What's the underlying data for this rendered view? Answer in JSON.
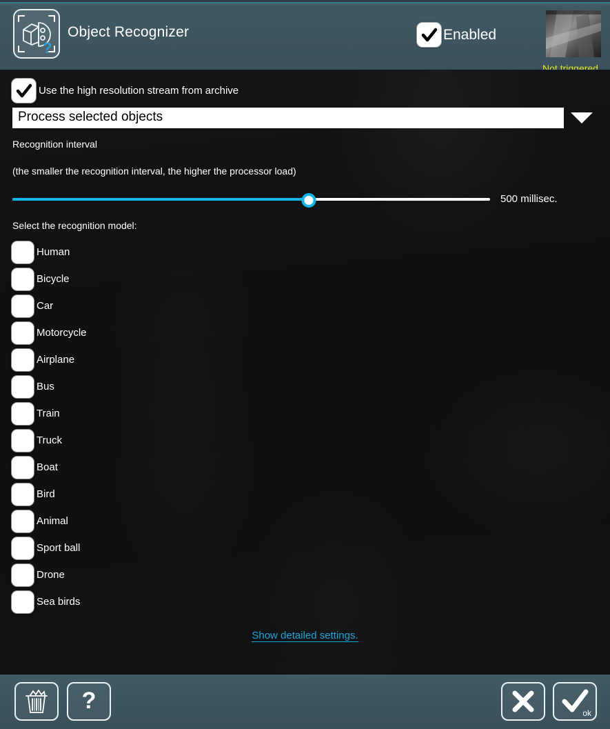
{
  "header": {
    "app_icon": "object-recognizer-icon",
    "title": "Object Recognizer",
    "enabled_label": "Enabled",
    "enabled_checked": true,
    "thumbnail_status": "Not triggered",
    "status_color": "#e8e81f",
    "background_color": "#3d555f"
  },
  "main": {
    "high_res": {
      "label": "Use the high resolution stream from archive",
      "checked": true
    },
    "mode_select": {
      "value": "Process selected objects",
      "arrow_icon": "chevron-down-icon"
    },
    "interval": {
      "label": "Recognition interval",
      "hint": "(the smaller the recognition interval, the higher the processor load)",
      "value_text": "500 millisec.",
      "percent": 62,
      "fill_color": "#13b5ea",
      "track_color": "#ffffff"
    },
    "models": {
      "label": "Select the recognition model:",
      "items": [
        {
          "label": "Human",
          "checked": false
        },
        {
          "label": "Bicycle",
          "checked": false
        },
        {
          "label": "Car",
          "checked": false
        },
        {
          "label": "Motorcycle",
          "checked": false
        },
        {
          "label": "Airplane",
          "checked": false
        },
        {
          "label": "Bus",
          "checked": false
        },
        {
          "label": "Train",
          "checked": false
        },
        {
          "label": "Truck",
          "checked": false
        },
        {
          "label": "Boat",
          "checked": false
        },
        {
          "label": "Bird",
          "checked": false
        },
        {
          "label": "Animal",
          "checked": false
        },
        {
          "label": "Sport ball",
          "checked": false
        },
        {
          "label": "Drone",
          "checked": false
        },
        {
          "label": "Sea birds",
          "checked": false
        }
      ]
    },
    "detailed_settings_link": "Show detailed settings.",
    "link_color": "#1aa6d6",
    "background_color": "#0f1113"
  },
  "bottom_bar": {
    "background_color": "#3d555f",
    "buttons": [
      {
        "name": "delete-button",
        "icon": "trash-icon",
        "label": ""
      },
      {
        "name": "help-button",
        "icon": "question-icon",
        "label": ""
      },
      {
        "name": "cancel-button",
        "icon": "close-x-icon",
        "label": ""
      },
      {
        "name": "ok-button",
        "icon": "checkmark-icon",
        "label": "ok"
      }
    ],
    "ok_label": "ok"
  }
}
